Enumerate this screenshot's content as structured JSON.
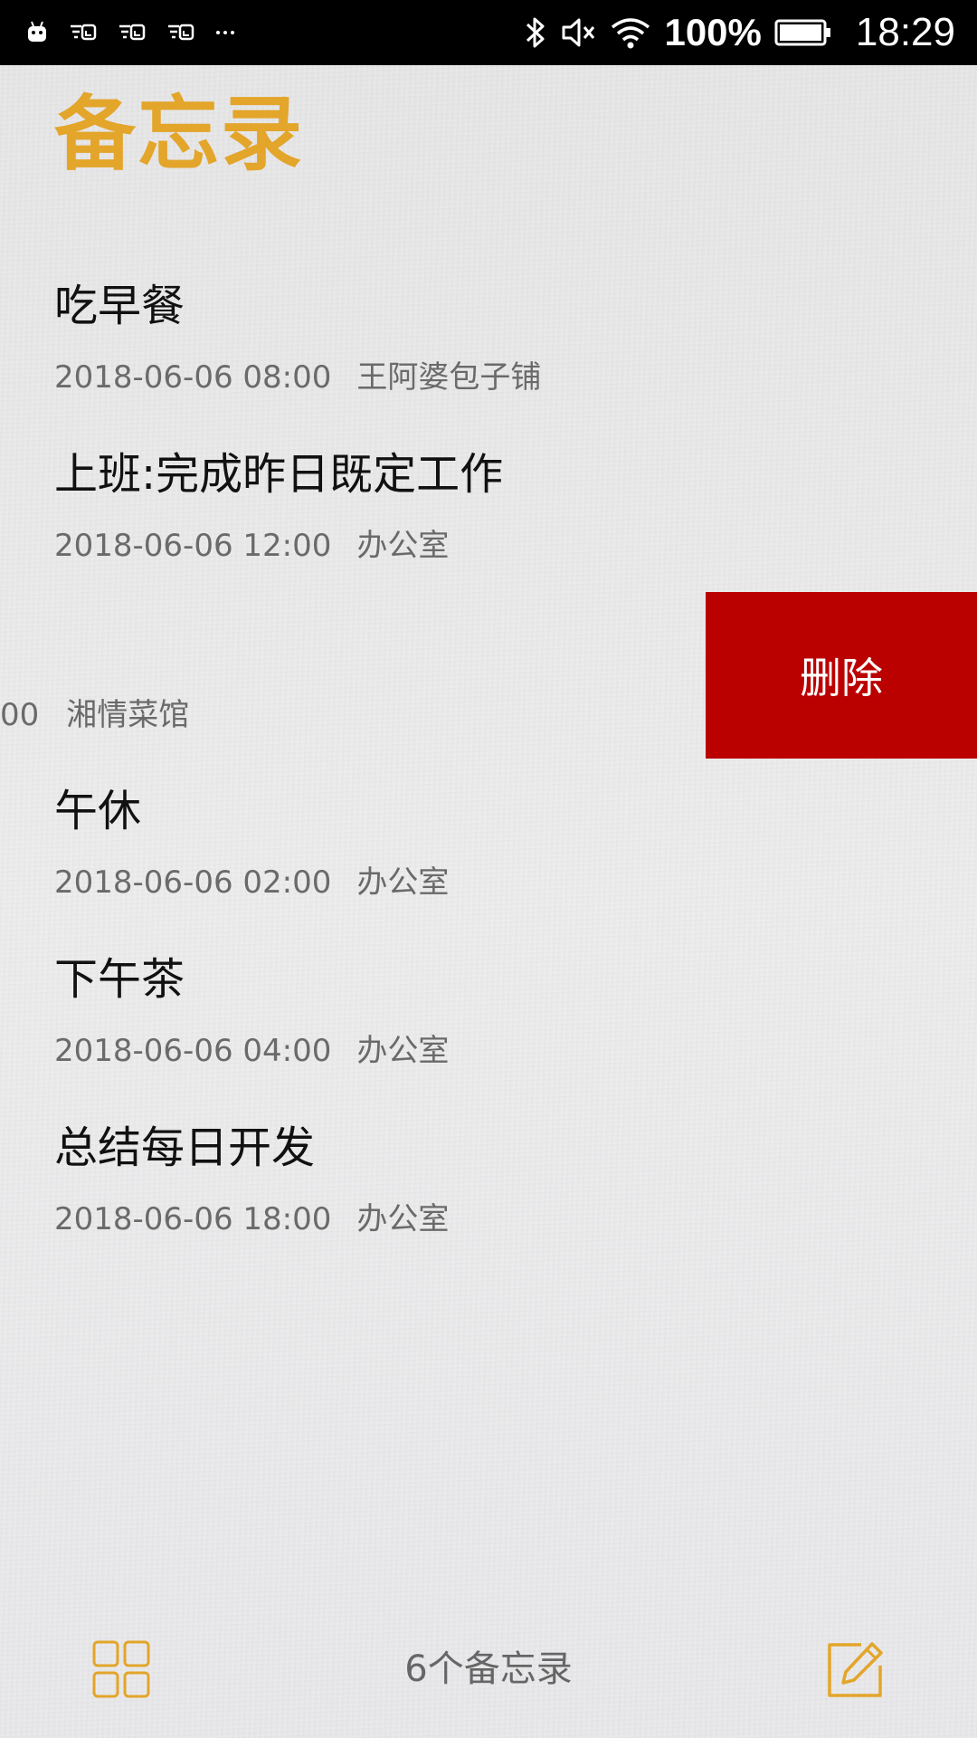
{
  "status_bar": {
    "battery_percent": "100%",
    "time": "18:29",
    "icons": [
      "android-icon",
      "notification-icon",
      "notification-icon",
      "notification-icon",
      "more-icon",
      "bluetooth-icon",
      "mute-icon",
      "wifi-icon",
      "battery-icon"
    ]
  },
  "header": {
    "title": "备忘录",
    "title_color": "#e3a52a"
  },
  "memos": [
    {
      "title": "吃早餐",
      "time": "2018-06-06 08:00",
      "location": "王阿婆包子铺"
    },
    {
      "title": "上班:完成昨日既定工作",
      "time": "2018-06-06 12:00",
      "location": "办公室"
    },
    {
      "title": "",
      "time_partial": "00",
      "location": "湘情菜馆"
    },
    {
      "title": "午休",
      "time": "2018-06-06 02:00",
      "location": "办公室"
    },
    {
      "title": "下午茶",
      "time": "2018-06-06 04:00",
      "location": "办公室"
    },
    {
      "title": "总结每日开发",
      "time": "2018-06-06 18:00",
      "location": "办公室"
    }
  ],
  "swipe_action": {
    "delete_label": "删除",
    "color": "#bb0000"
  },
  "footer": {
    "count_label": "6个备忘录",
    "accent_color": "#e3a52a"
  }
}
